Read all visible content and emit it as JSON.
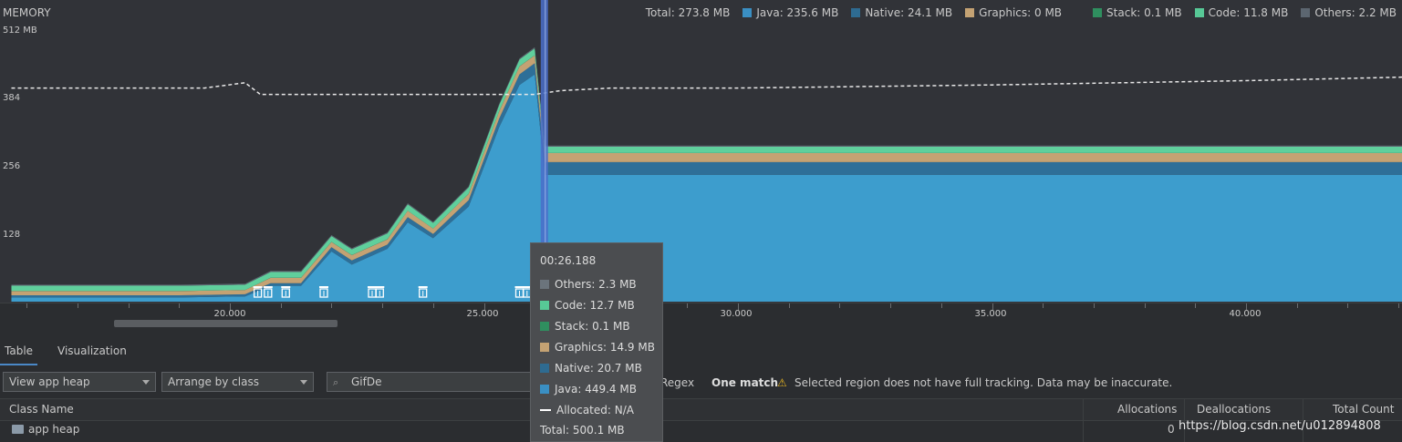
{
  "memory": {
    "title": "MEMORY",
    "y_labels": [
      "512 MB",
      "384",
      "256",
      "128"
    ],
    "legend": [
      {
        "label": "Total: 273.8 MB",
        "color": ""
      },
      {
        "label": "Java: 235.6 MB",
        "color": "#3a8fc3"
      },
      {
        "label": "Native: 24.1 MB",
        "color": "#2e6b91"
      },
      {
        "label": "Graphics: 0 MB",
        "color": "#c4a273"
      },
      {
        "label": "Stack: 0.1 MB",
        "color": "#2f8f5f"
      },
      {
        "label": "Code: 11.8 MB",
        "color": "#57c896"
      },
      {
        "label": "Others: 2.2 MB",
        "color": "#5c6670"
      }
    ]
  },
  "timeline": {
    "tick_labels": [
      "20.000",
      "25.000",
      "30.000",
      "35.000",
      "40.000"
    ]
  },
  "tabs": [
    {
      "label": "Table",
      "active": true
    },
    {
      "label": "Visualization",
      "active": false
    }
  ],
  "toolbar": {
    "heap_select": "View app heap",
    "arrange_select": "Arrange by class",
    "search_value": "GifDe",
    "regex_label": "Regex",
    "match_label": "One match",
    "warning_text": "Selected region does not have full tracking. Data may be inaccurate."
  },
  "table": {
    "headers": [
      "Class Name",
      "Allocations",
      "Deallocations",
      "Total Count"
    ],
    "rows": [
      {
        "name": "app heap",
        "allocations": "0",
        "deallocations": "",
        "total": ""
      }
    ]
  },
  "tooltip": {
    "time": "00:26.188",
    "rows": [
      {
        "label": "Others: 2.3 MB",
        "color": "#6b747c"
      },
      {
        "label": "Code: 12.7 MB",
        "color": "#57c896"
      },
      {
        "label": "Stack: 0.1 MB",
        "color": "#2f8f5f"
      },
      {
        "label": "Graphics: 14.9 MB",
        "color": "#c4a273"
      },
      {
        "label": "Native: 20.7 MB",
        "color": "#2e6b91"
      },
      {
        "label": "Java: 449.4 MB",
        "color": "#3a8fc3"
      },
      {
        "label": "Allocated: N/A",
        "color": "dash"
      }
    ],
    "total": "Total: 500.1 MB"
  },
  "watermark": "https://blog.csdn.net/u012894808",
  "chart_data": {
    "type": "area",
    "title": "MEMORY",
    "ylabel": "",
    "ylim": [
      0,
      512
    ],
    "x_ticks": [
      20,
      25,
      30,
      35,
      40
    ],
    "x": [
      15.7,
      16.8,
      18.0,
      19.0,
      20.3,
      20.8,
      21.4,
      22.0,
      22.4,
      23.1,
      23.5,
      24.0,
      24.7,
      25.3,
      25.7,
      26.0,
      26.2,
      26.6,
      27.3,
      30.0,
      35.0,
      40.0,
      43.2
    ],
    "series": [
      {
        "name": "Java",
        "values": [
          8,
          8,
          8,
          8,
          10,
          30,
          30,
          95,
          70,
          100,
          150,
          120,
          180,
          330,
          410,
          430,
          240,
          240,
          240,
          240,
          240,
          240,
          240
        ]
      },
      {
        "name": "Native",
        "values": [
          4,
          4,
          4,
          4,
          4,
          5,
          5,
          8,
          8,
          8,
          10,
          8,
          12,
          16,
          20,
          21,
          24,
          24,
          24,
          24,
          24,
          24,
          24
        ]
      },
      {
        "name": "Graphics",
        "values": [
          8,
          8,
          8,
          8,
          8,
          10,
          10,
          10,
          10,
          10,
          12,
          10,
          12,
          14,
          15,
          15,
          17,
          17,
          17,
          17,
          17,
          17,
          17
        ]
      },
      {
        "name": "Stack",
        "values": [
          0.1,
          0.1,
          0.1,
          0.1,
          0.1,
          0.1,
          0.1,
          0.1,
          0.1,
          0.1,
          0.1,
          0.1,
          0.1,
          0.1,
          0.1,
          0.1,
          0.1,
          0.1,
          0.1,
          0.1,
          0.1,
          0.1,
          0.1
        ]
      },
      {
        "name": "Code",
        "values": [
          10,
          10,
          10,
          10,
          10,
          11,
          11,
          11,
          11,
          11,
          12,
          11,
          12,
          12,
          13,
          13,
          12,
          12,
          12,
          12,
          12,
          12,
          12
        ]
      },
      {
        "name": "Others",
        "values": [
          2,
          2,
          2,
          2,
          2,
          2,
          2,
          2,
          2,
          2,
          2,
          2,
          2,
          2,
          2,
          2.3,
          2.2,
          2.2,
          2.2,
          2.2,
          2.2,
          2.2,
          2.2
        ]
      }
    ],
    "allocated_line": {
      "x": [
        15.7,
        19.5,
        20.3,
        20.6,
        24.0,
        26.0,
        26.5,
        27.5,
        30.0,
        35.0,
        40.0,
        43.2
      ],
      "values": [
        404,
        404,
        414,
        392,
        392,
        392,
        399,
        404,
        404,
        410,
        418,
        425
      ]
    },
    "gc_events_x": [
      20.55,
      20.75,
      21.1,
      21.85,
      22.8,
      22.95,
      23.8,
      25.7,
      25.85
    ],
    "selection_x": 26.19,
    "legend_position": "top-right",
    "grid": false
  }
}
